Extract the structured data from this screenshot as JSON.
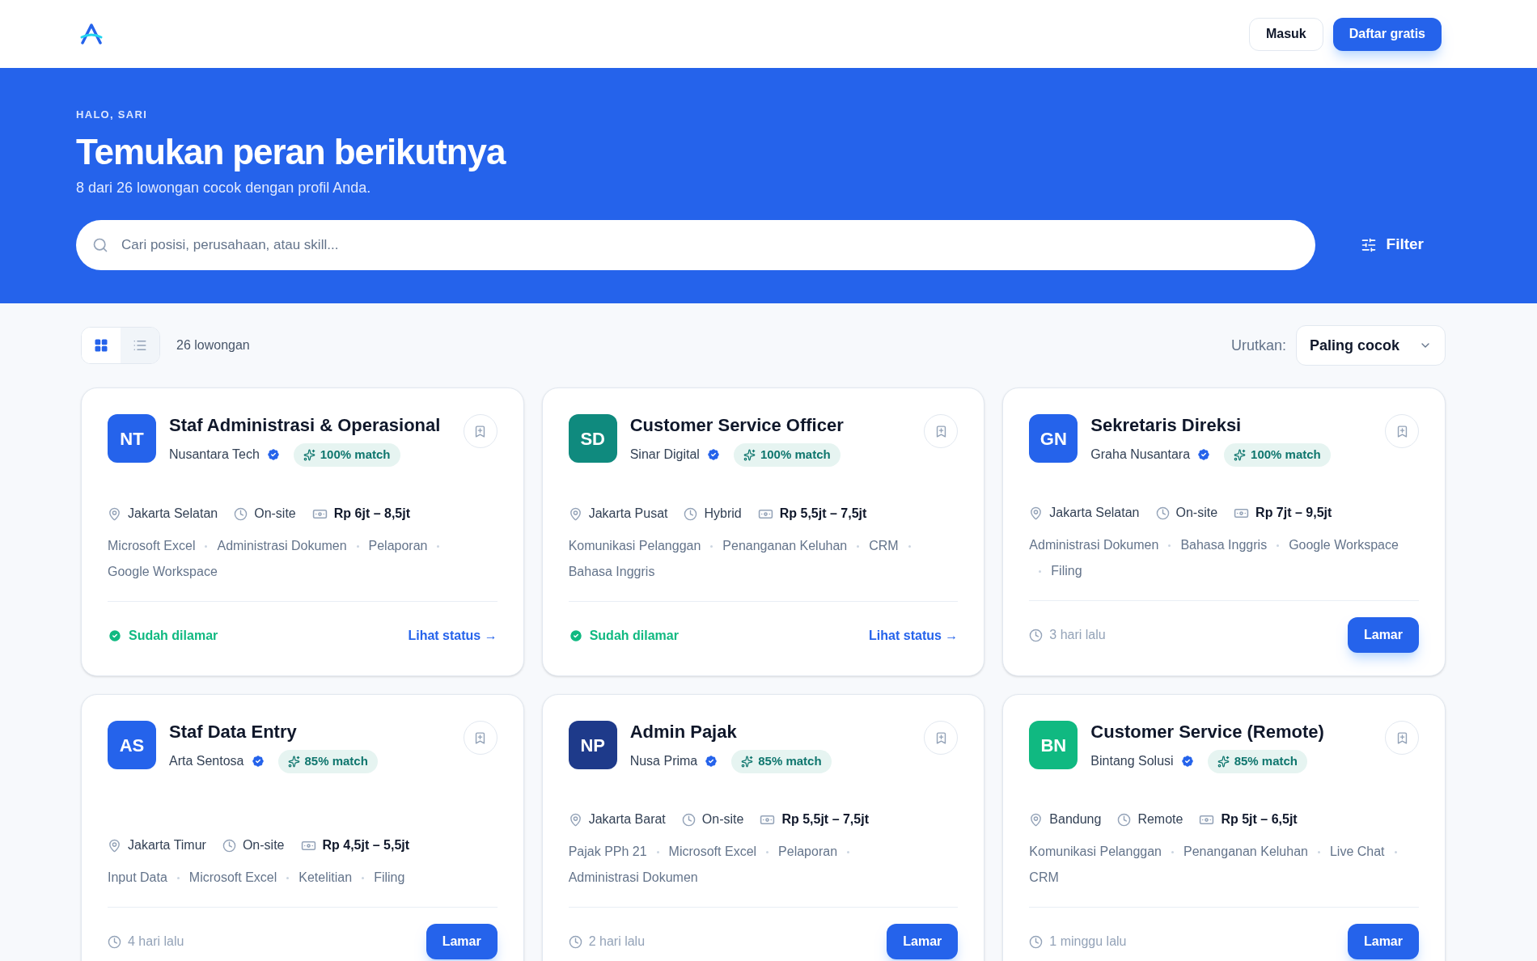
{
  "header": {
    "buttons": [
      {
        "label": "Masuk",
        "kind": "outline"
      },
      {
        "label": "Daftar gratis",
        "kind": "primary"
      }
    ]
  },
  "hero": {
    "eyebrow": "HALO, SARI",
    "title": "Temukan peran berikutnya",
    "subtitle": "8 dari 26 lowongan cocok dengan profil Anda.",
    "search": {
      "placeholder": "Cari posisi, perusahaan, atau skill..."
    },
    "filter": "Filter"
  },
  "toolbar": {
    "views": [
      {
        "kind": "grid",
        "selected": true
      },
      {
        "kind": "list",
        "selected": false
      }
    ],
    "count": "26 lowongan",
    "sort_label": "Urutkan:",
    "sort_value": "Paling cocok"
  },
  "jobs": [
    {
      "initials": "NT",
      "color": "#2563eb",
      "title": "Staf Administrasi & Operasional",
      "company": "Nusantara Tech",
      "verified": true,
      "match": "100% match",
      "location": "Jakarta Selatan",
      "mode": "On-site",
      "salary": "Rp 6jt – 8,5jt",
      "tags": [
        "Microsoft Excel",
        "Administrasi Dokumen",
        "Pelaporan",
        "Google Workspace"
      ],
      "kind": "applied",
      "status": "Sudah dilamar",
      "action": "Lihat status →"
    },
    {
      "initials": "SD",
      "color": "#0f8a7e",
      "title": "Customer Service Officer",
      "company": "Sinar Digital",
      "verified": true,
      "match": "100% match",
      "location": "Jakarta Pusat",
      "mode": "Hybrid",
      "salary": "Rp 5,5jt – 7,5jt",
      "tags": [
        "Komunikasi Pelanggan",
        "Penanganan Keluhan",
        "CRM",
        "Bahasa Inggris"
      ],
      "kind": "applied",
      "status": "Sudah dilamar",
      "action": "Lihat status →"
    },
    {
      "initials": "GN",
      "color": "#2563eb",
      "title": "Sekretaris Direksi",
      "company": "Graha Nusantara",
      "verified": true,
      "match": "100% match",
      "location": "Jakarta Selatan",
      "mode": "On-site",
      "salary": "Rp 7jt – 9,5jt",
      "tags": [
        "Administrasi Dokumen",
        "Bahasa Inggris",
        "Google Workspace",
        "Filing"
      ],
      "kind": "open",
      "status": "3 hari lalu",
      "action": "Lamar"
    },
    {
      "initials": "AS",
      "color": "#2563eb",
      "title": "Staf Data Entry",
      "company": "Arta Sentosa",
      "verified": true,
      "match": "85% match",
      "location": "Jakarta Timur",
      "mode": "On-site",
      "salary": "Rp 4,5jt – 5,5jt",
      "tags": [
        "Input Data",
        "Microsoft Excel",
        "Ketelitian",
        "Filing"
      ],
      "kind": "open",
      "status": "4 hari lalu",
      "action": "Lamar"
    },
    {
      "initials": "NP",
      "color": "#1e3a8a",
      "title": "Admin Pajak",
      "company": "Nusa Prima",
      "verified": true,
      "match": "85% match",
      "location": "Jakarta Barat",
      "mode": "On-site",
      "salary": "Rp 5,5jt – 7,5jt",
      "tags": [
        "Pajak PPh 21",
        "Microsoft Excel",
        "Pelaporan",
        "Administrasi Dokumen"
      ],
      "kind": "open",
      "status": "2 hari lalu",
      "action": "Lamar"
    },
    {
      "initials": "BN",
      "color": "#10b981",
      "title": "Customer Service (Remote)",
      "company": "Bintang Solusi",
      "verified": true,
      "match": "85% match",
      "location": "Bandung",
      "mode": "Remote",
      "salary": "Rp 5jt – 6,5jt",
      "tags": [
        "Komunikasi Pelanggan",
        "Penanganan Keluhan",
        "Live Chat",
        "CRM"
      ],
      "kind": "open",
      "status": "1 minggu lalu",
      "action": "Lamar"
    }
  ]
}
